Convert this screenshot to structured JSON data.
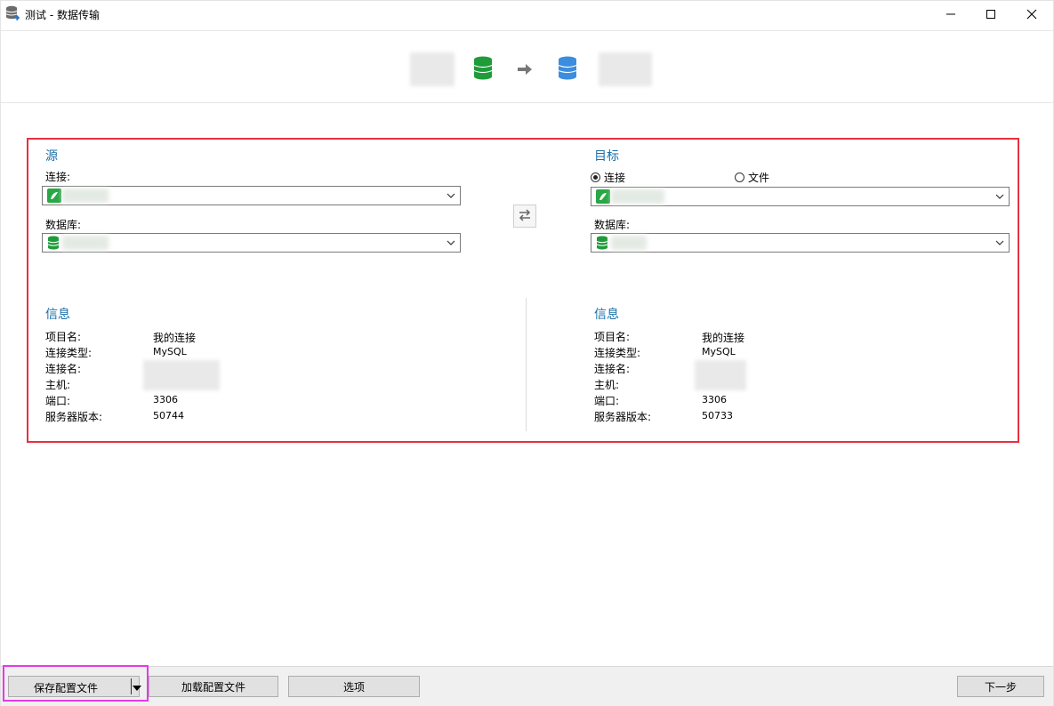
{
  "window": {
    "title": "测试 - 数据传输"
  },
  "source": {
    "heading": "源",
    "connection_label": "连接:",
    "database_label": "数据库:",
    "info_heading": "信息",
    "info": {
      "project_name_key": "项目名:",
      "project_name_value": "我的连接",
      "connection_type_key": "连接类型:",
      "connection_type_value": "MySQL",
      "connection_name_key": "连接名:",
      "host_key": "主机:",
      "port_key": "端口:",
      "port_value": "3306",
      "server_version_key": "服务器版本:",
      "server_version_value": "50744"
    }
  },
  "target": {
    "heading": "目标",
    "radio_connection": "连接",
    "radio_file": "文件",
    "selected_mode": "connection",
    "database_label": "数据库:",
    "info_heading": "信息",
    "info": {
      "project_name_key": "项目名:",
      "project_name_value": "我的连接",
      "connection_type_key": "连接类型:",
      "connection_type_value": "MySQL",
      "connection_name_key": "连接名:",
      "host_key": "主机:",
      "port_key": "端口:",
      "port_value": "3306",
      "server_version_key": "服务器版本:",
      "server_version_value": "50733"
    }
  },
  "buttons": {
    "save_profile": "保存配置文件",
    "load_profile": "加载配置文件",
    "options": "选项",
    "next": "下一步"
  },
  "icons": {
    "app": "database-transfer-icon",
    "minimize": "minimize-icon",
    "maximize": "maximize-icon",
    "close": "close-icon",
    "source_db": "database-green-icon",
    "arrow": "arrow-right-icon",
    "target_db": "database-blue-icon",
    "swap": "swap-arrows-icon",
    "connection": "mysql-connection-icon",
    "dropdown": "chevron-down-icon"
  },
  "colors": {
    "accent_text": "#1a6fa8",
    "highlight_red": "#e8303f",
    "highlight_magenta": "#e23be8",
    "db_green": "#1f9b3a",
    "db_blue": "#3b8de0"
  }
}
